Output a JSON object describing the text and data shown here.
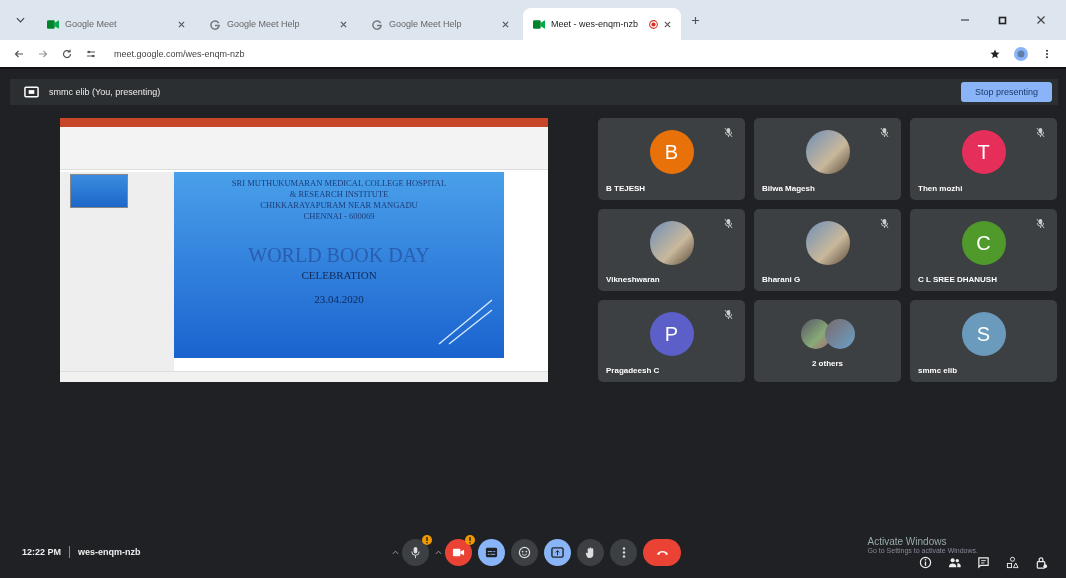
{
  "browser": {
    "tabs": [
      {
        "title": "Google Meet",
        "kind": "meet",
        "selected": false,
        "recording": false
      },
      {
        "title": "Google Meet Help",
        "kind": "google",
        "selected": false,
        "recording": false
      },
      {
        "title": "Google Meet Help",
        "kind": "google",
        "selected": false,
        "recording": false
      },
      {
        "title": "Meet - wes-enqm-nzb",
        "kind": "meet",
        "selected": true,
        "recording": true
      }
    ],
    "url": "meet.google.com/wes-enqm-nzb"
  },
  "presenting_bar": {
    "label": "smmc elib (You, presenting)",
    "button": "Stop presenting"
  },
  "slide": {
    "header_lines": [
      "SRI MUTHUKUMARAN MEDICAL COLLEGE HOSPITAL",
      "& RESEARCH INSTITUTE",
      "CHIKKARAYAPURAM NEAR MANGADU",
      "CHENNAI - 600069"
    ],
    "title": "WORLD BOOK DAY",
    "subtitle": "CELEBRATION",
    "date": "23.04.2020"
  },
  "participants": [
    {
      "name": "B TEJESH",
      "kind": "initial",
      "initial": "B",
      "color": "#e8710a",
      "muted": true
    },
    {
      "name": "Bilwa Magesh",
      "kind": "photo",
      "muted": true
    },
    {
      "name": "Then mozhi",
      "kind": "initial",
      "initial": "T",
      "color": "#e52e5a",
      "muted": true
    },
    {
      "name": "Vikneshwaran",
      "kind": "photo",
      "muted": true
    },
    {
      "name": "Bharani G",
      "kind": "photo",
      "muted": true
    },
    {
      "name": "C L SREE DHANUSH",
      "kind": "initial",
      "initial": "C",
      "color": "#4f9a2a",
      "muted": true
    },
    {
      "name": "Pragadeesh C",
      "kind": "initial",
      "initial": "P",
      "color": "#5b5fc7",
      "muted": true
    },
    {
      "name": "2 others",
      "kind": "group",
      "muted": false
    },
    {
      "name": "smmc elib",
      "kind": "initial",
      "initial": "S",
      "color": "#6a9bbd",
      "muted": false
    }
  ],
  "bottom_bar": {
    "time": "12:22 PM",
    "meeting_code": "wes-enqm-nzb",
    "controls": [
      {
        "kind": "mic",
        "active": false,
        "off": false,
        "warning": true
      },
      {
        "kind": "camera",
        "active": false,
        "off": true,
        "warning": true
      },
      {
        "kind": "captions",
        "active": true,
        "off": false,
        "warning": false
      },
      {
        "kind": "emoji",
        "active": false,
        "off": false,
        "warning": false
      },
      {
        "kind": "present",
        "active": true,
        "off": false,
        "warning": false
      },
      {
        "kind": "hand",
        "active": false,
        "off": false,
        "warning": false
      },
      {
        "kind": "more",
        "active": false,
        "off": false,
        "warning": false
      },
      {
        "kind": "hangup",
        "active": false,
        "off": true,
        "warning": false
      }
    ],
    "side_icons": [
      {
        "kind": "info"
      },
      {
        "kind": "people"
      },
      {
        "kind": "chat"
      },
      {
        "kind": "activities"
      },
      {
        "kind": "lock"
      }
    ]
  },
  "os_notice": {
    "title": "Activate Windows",
    "detail": "Go to Settings to activate Windows."
  }
}
